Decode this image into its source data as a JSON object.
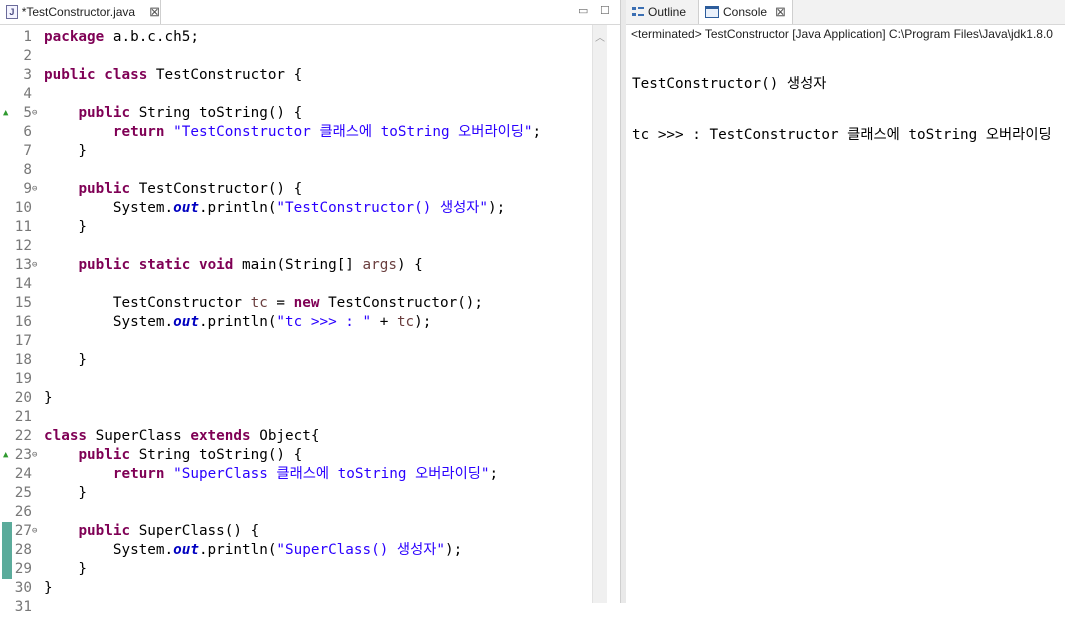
{
  "editor": {
    "tab_label": "*TestConstructor.java",
    "file_icon_letter": "J",
    "lines": [
      {
        "n": "1",
        "fold": "",
        "ovr": "",
        "chg": false,
        "tokens": [
          {
            "t": "package",
            "c": "kw"
          },
          {
            "t": " a.b.c.ch5;",
            "c": ""
          }
        ]
      },
      {
        "n": "2",
        "fold": "",
        "ovr": "",
        "chg": false,
        "tokens": []
      },
      {
        "n": "3",
        "fold": "",
        "ovr": "",
        "chg": false,
        "tokens": [
          {
            "t": "public",
            "c": "kw"
          },
          {
            "t": " ",
            "c": ""
          },
          {
            "t": "class",
            "c": "kw"
          },
          {
            "t": " TestConstructor {",
            "c": ""
          }
        ]
      },
      {
        "n": "4",
        "fold": "",
        "ovr": "",
        "chg": false,
        "tokens": []
      },
      {
        "n": "5",
        "fold": "⊖",
        "ovr": "▲",
        "chg": false,
        "tokens": [
          {
            "t": "    ",
            "c": ""
          },
          {
            "t": "public",
            "c": "kw"
          },
          {
            "t": " String toString() {",
            "c": ""
          }
        ]
      },
      {
        "n": "6",
        "fold": "",
        "ovr": "",
        "chg": false,
        "tokens": [
          {
            "t": "        ",
            "c": ""
          },
          {
            "t": "return",
            "c": "kw"
          },
          {
            "t": " ",
            "c": ""
          },
          {
            "t": "\"TestConstructor 클래스에 toString 오버라이딩\"",
            "c": "str"
          },
          {
            "t": ";",
            "c": ""
          }
        ]
      },
      {
        "n": "7",
        "fold": "",
        "ovr": "",
        "chg": false,
        "tokens": [
          {
            "t": "    }",
            "c": ""
          }
        ]
      },
      {
        "n": "8",
        "fold": "",
        "ovr": "",
        "chg": false,
        "tokens": []
      },
      {
        "n": "9",
        "fold": "⊖",
        "ovr": "",
        "chg": false,
        "tokens": [
          {
            "t": "    ",
            "c": ""
          },
          {
            "t": "public",
            "c": "kw"
          },
          {
            "t": " TestConstructor() {",
            "c": ""
          }
        ]
      },
      {
        "n": "10",
        "fold": "",
        "ovr": "",
        "chg": false,
        "tokens": [
          {
            "t": "        System.",
            "c": ""
          },
          {
            "t": "out",
            "c": "fld"
          },
          {
            "t": ".println(",
            "c": ""
          },
          {
            "t": "\"TestConstructor() 생성자\"",
            "c": "str"
          },
          {
            "t": ");",
            "c": ""
          }
        ]
      },
      {
        "n": "11",
        "fold": "",
        "ovr": "",
        "chg": false,
        "tokens": [
          {
            "t": "    }",
            "c": ""
          }
        ]
      },
      {
        "n": "12",
        "fold": "",
        "ovr": "",
        "chg": false,
        "tokens": []
      },
      {
        "n": "13",
        "fold": "⊖",
        "ovr": "",
        "chg": false,
        "tokens": [
          {
            "t": "    ",
            "c": ""
          },
          {
            "t": "public",
            "c": "kw"
          },
          {
            "t": " ",
            "c": ""
          },
          {
            "t": "static",
            "c": "kw"
          },
          {
            "t": " ",
            "c": ""
          },
          {
            "t": "void",
            "c": "kw"
          },
          {
            "t": " main(String[] ",
            "c": ""
          },
          {
            "t": "args",
            "c": "var"
          },
          {
            "t": ") {",
            "c": ""
          }
        ]
      },
      {
        "n": "14",
        "fold": "",
        "ovr": "",
        "chg": false,
        "tokens": []
      },
      {
        "n": "15",
        "fold": "",
        "ovr": "",
        "chg": false,
        "tokens": [
          {
            "t": "        TestConstructor ",
            "c": ""
          },
          {
            "t": "tc",
            "c": "var"
          },
          {
            "t": " = ",
            "c": ""
          },
          {
            "t": "new",
            "c": "kw"
          },
          {
            "t": " TestConstructor();",
            "c": ""
          }
        ]
      },
      {
        "n": "16",
        "fold": "",
        "ovr": "",
        "chg": false,
        "tokens": [
          {
            "t": "        System.",
            "c": ""
          },
          {
            "t": "out",
            "c": "fld"
          },
          {
            "t": ".println(",
            "c": ""
          },
          {
            "t": "\"tc >>> : \"",
            "c": "str"
          },
          {
            "t": " + ",
            "c": ""
          },
          {
            "t": "tc",
            "c": "var"
          },
          {
            "t": ");",
            "c": ""
          }
        ]
      },
      {
        "n": "17",
        "fold": "",
        "ovr": "",
        "chg": false,
        "tokens": []
      },
      {
        "n": "18",
        "fold": "",
        "ovr": "",
        "chg": false,
        "tokens": [
          {
            "t": "    }",
            "c": ""
          }
        ]
      },
      {
        "n": "19",
        "fold": "",
        "ovr": "",
        "chg": false,
        "tokens": []
      },
      {
        "n": "20",
        "fold": "",
        "ovr": "",
        "chg": false,
        "tokens": [
          {
            "t": "}",
            "c": ""
          }
        ]
      },
      {
        "n": "21",
        "fold": "",
        "ovr": "",
        "chg": false,
        "tokens": []
      },
      {
        "n": "22",
        "fold": "",
        "ovr": "",
        "chg": false,
        "tokens": [
          {
            "t": "class",
            "c": "kw"
          },
          {
            "t": " SuperClass ",
            "c": ""
          },
          {
            "t": "extends",
            "c": "kw"
          },
          {
            "t": " Object{",
            "c": ""
          }
        ]
      },
      {
        "n": "23",
        "fold": "⊖",
        "ovr": "▲",
        "chg": false,
        "tokens": [
          {
            "t": "    ",
            "c": ""
          },
          {
            "t": "public",
            "c": "kw"
          },
          {
            "t": " String toString() {",
            "c": ""
          }
        ]
      },
      {
        "n": "24",
        "fold": "",
        "ovr": "",
        "chg": false,
        "tokens": [
          {
            "t": "        ",
            "c": ""
          },
          {
            "t": "return",
            "c": "kw"
          },
          {
            "t": " ",
            "c": ""
          },
          {
            "t": "\"SuperClass 클래스에 toString 오버라이딩\"",
            "c": "str"
          },
          {
            "t": ";",
            "c": ""
          }
        ]
      },
      {
        "n": "25",
        "fold": "",
        "ovr": "",
        "chg": false,
        "tokens": [
          {
            "t": "    }",
            "c": ""
          }
        ]
      },
      {
        "n": "26",
        "fold": "",
        "ovr": "",
        "chg": false,
        "tokens": []
      },
      {
        "n": "27",
        "fold": "⊖",
        "ovr": "",
        "chg": true,
        "tokens": [
          {
            "t": "    ",
            "c": ""
          },
          {
            "t": "public",
            "c": "kw"
          },
          {
            "t": " SuperClass() {",
            "c": ""
          }
        ]
      },
      {
        "n": "28",
        "fold": "",
        "ovr": "",
        "chg": true,
        "tokens": [
          {
            "t": "        System.",
            "c": ""
          },
          {
            "t": "out",
            "c": "fld"
          },
          {
            "t": ".println(",
            "c": ""
          },
          {
            "t": "\"SuperClass() 생성자\"",
            "c": "str"
          },
          {
            "t": ");",
            "c": ""
          }
        ]
      },
      {
        "n": "29",
        "fold": "",
        "ovr": "",
        "chg": true,
        "tokens": [
          {
            "t": "    }",
            "c": ""
          }
        ]
      },
      {
        "n": "30",
        "fold": "",
        "ovr": "",
        "chg": false,
        "tokens": [
          {
            "t": "}",
            "c": ""
          }
        ]
      },
      {
        "n": "31",
        "fold": "",
        "ovr": "",
        "chg": false,
        "tokens": []
      }
    ]
  },
  "side": {
    "outline_tab": "Outline",
    "console_tab": "Console",
    "terminated": "<terminated> TestConstructor [Java Application] C:\\Program Files\\Java\\jdk1.8.0",
    "output": [
      "TestConstructor() 생성자",
      "tc >>> : TestConstructor 클래스에 toString 오버라이딩"
    ]
  },
  "colors": {
    "keyword": "#7f0055",
    "string": "#2a00ff",
    "field": "#0000c0",
    "local": "#6a3e3e",
    "change_bar": "#5bab9b"
  }
}
